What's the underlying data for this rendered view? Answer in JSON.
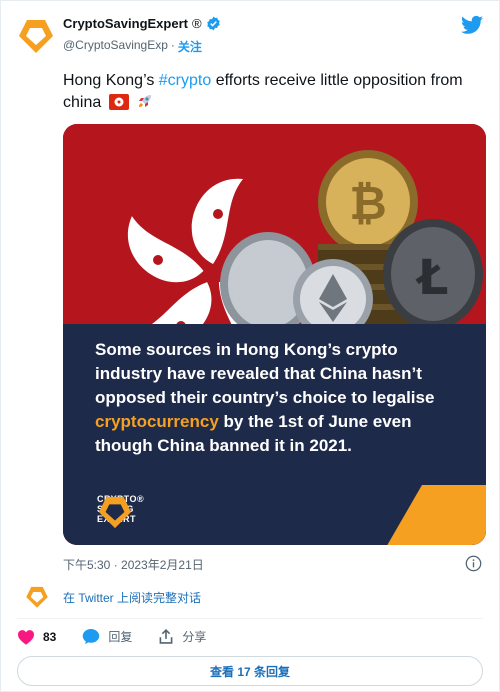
{
  "account": {
    "name": "CryptoSavingExpert",
    "registered": "®",
    "handle": "@CryptoSavingExp",
    "separator": "·",
    "follow_label": "关注"
  },
  "tweet": {
    "text_before": "Hong Kong’s ",
    "hashtag": "#crypto",
    "text_after": " efforts receive little opposition from china",
    "emoji_icons": [
      "hong-kong-flag-icon",
      "rocket-icon"
    ]
  },
  "media": {
    "body_part1": "Some sources in Hong Kong’s crypto industry have revealed that China hasn’t opposed their country’s choice to legalise ",
    "highlight": "cryptocurrency",
    "body_part2": " by the 1st of June even though China banned it in 2021.",
    "brand_line1": "CRYPTO",
    "brand_line2": "SAVING",
    "brand_line3": "EXPERT",
    "brand_reg": "®",
    "colors": {
      "panel": "#1e2a4a",
      "accent": "#f5a020",
      "flag_red": "#b5161e"
    }
  },
  "timestamp": "下午5:30 · 2023年2月21日",
  "read_on_twitter": "在 Twitter 上阅读完整对话",
  "actions": {
    "likes": "83",
    "reply_label": "回复",
    "share_label": "分享"
  },
  "more_replies_label": "查看 17 条回复",
  "colors": {
    "twitter_blue": "#1d9bf0",
    "like_pink": "#f91880"
  }
}
